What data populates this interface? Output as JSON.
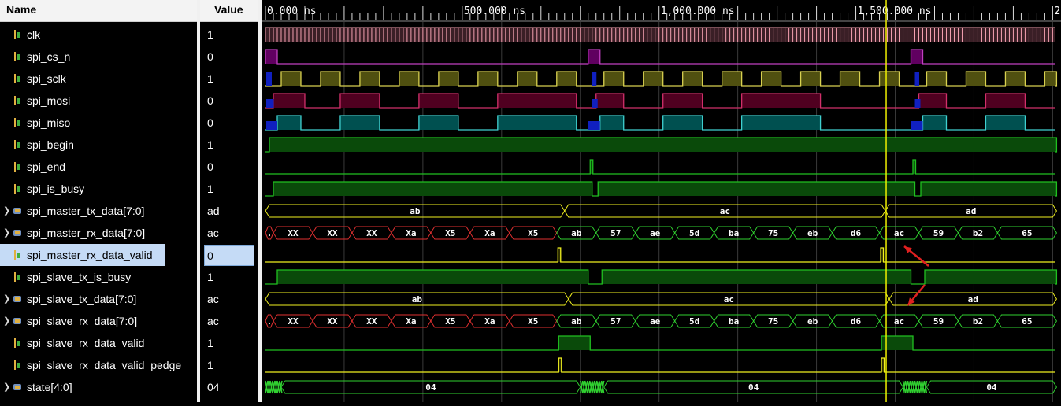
{
  "header": {
    "name_label": "Name",
    "value_label": "Value"
  },
  "timeline": {
    "labels": [
      {
        "t": 0,
        "text": "0.000 ns"
      },
      {
        "t": 500,
        "text": "500.000 ns"
      },
      {
        "t": 1000,
        "text": "1,000.000 ns"
      },
      {
        "t": 1500,
        "text": "1,500.000 ns"
      },
      {
        "t": 2000,
        "text": "2"
      }
    ],
    "cursor_ns": 1577
  },
  "signals": [
    {
      "name": "clk",
      "value": "1",
      "kind": "bit",
      "expandable": false
    },
    {
      "name": "spi_cs_n",
      "value": "0",
      "kind": "bit",
      "expandable": false
    },
    {
      "name": "spi_sclk",
      "value": "1",
      "kind": "bit",
      "expandable": false
    },
    {
      "name": "spi_mosi",
      "value": "0",
      "kind": "bit",
      "expandable": false
    },
    {
      "name": "spi_miso",
      "value": "0",
      "kind": "bit",
      "expandable": false
    },
    {
      "name": "spi_begin",
      "value": "1",
      "kind": "bit",
      "expandable": false
    },
    {
      "name": "spi_end",
      "value": "0",
      "kind": "bit",
      "expandable": false
    },
    {
      "name": "spi_is_busy",
      "value": "1",
      "kind": "bit",
      "expandable": false
    },
    {
      "name": "spi_master_tx_data[7:0]",
      "value": "ad",
      "kind": "bus",
      "expandable": true
    },
    {
      "name": "spi_master_rx_data[7:0]",
      "value": "ac",
      "kind": "bus",
      "expandable": true
    },
    {
      "name": "spi_master_rx_data_valid",
      "value": "0",
      "kind": "bit",
      "expandable": false,
      "selected": true
    },
    {
      "name": "spi_slave_tx_is_busy",
      "value": "1",
      "kind": "bit",
      "expandable": false
    },
    {
      "name": "spi_slave_tx_data[7:0]",
      "value": "ac",
      "kind": "bus",
      "expandable": true
    },
    {
      "name": "spi_slave_rx_data[7:0]",
      "value": "ac",
      "kind": "bus",
      "expandable": true
    },
    {
      "name": "spi_slave_rx_data_valid",
      "value": "1",
      "kind": "bit",
      "expandable": false
    },
    {
      "name": "spi_slave_rx_data_valid_pedge",
      "value": "1",
      "kind": "bit",
      "expandable": false
    },
    {
      "name": "state[4:0]",
      "value": "04",
      "kind": "bus",
      "expandable": true
    }
  ],
  "bus_labels": {
    "master_tx": [
      "ab",
      "ac",
      "ad"
    ],
    "rx": [
      ".",
      "XX",
      "XX",
      "XX",
      "Xa",
      "X5",
      "Xa",
      "X5",
      "ab",
      "57",
      "ae",
      "5d",
      "ba",
      "75",
      "eb",
      "d6",
      "ac",
      "59",
      "b2",
      "65"
    ],
    "slave_tx": [
      "ab",
      "ac",
      "ad"
    ],
    "state": [
      "04",
      "04",
      "04"
    ]
  },
  "colors": {
    "clk": "#f4a0b0",
    "cs": "#c040c0",
    "sclk": "#d8d050",
    "mosi": "#d0306a",
    "miso": "#40d0d0",
    "green": "#20c020",
    "bus": "#f0f020",
    "bus_red": "#e03030",
    "bus_green": "#30d030",
    "cursor": "#f0f000",
    "arrow": "#e02020"
  }
}
